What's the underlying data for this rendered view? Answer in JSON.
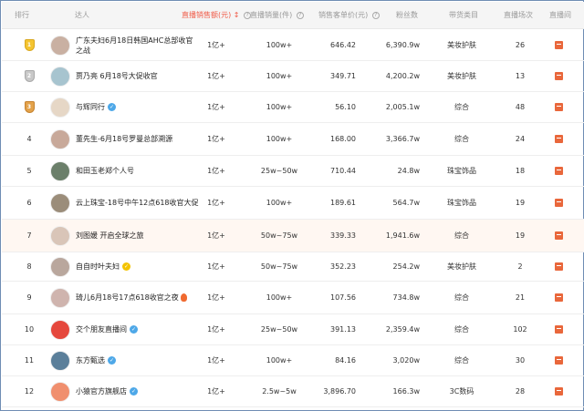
{
  "header": {
    "rank": "排行",
    "talent": "达人",
    "sales": "直播销售额(元)",
    "volume": "直播销量(件)",
    "price": "销售客单价(元)",
    "fans": "粉丝数",
    "category": "带货类目",
    "count": "直播场次",
    "live": "直播间",
    "info_glyph": "?",
    "sort_glyph": "↕"
  },
  "rows": [
    {
      "rank": "1",
      "medal": "gold",
      "name": "广东夫妇6月18日韩国AHC总部收官之战",
      "badge": "",
      "sales": "1亿+",
      "volume": "100w+",
      "price": "646.42",
      "fans": "6,390.9w",
      "category": "美妆护肤",
      "count": "26",
      "avatar_color": "#c9b0a2"
    },
    {
      "rank": "2",
      "medal": "silver",
      "name": "贾乃亮 6月18号大促收官",
      "badge": "",
      "sales": "1亿+",
      "volume": "100w+",
      "price": "349.71",
      "fans": "4,200.2w",
      "category": "美妆护肤",
      "count": "13",
      "avatar_color": "#a7c4cf"
    },
    {
      "rank": "3",
      "medal": "bronze",
      "name": "与辉同行",
      "badge": "blue",
      "sales": "1亿+",
      "volume": "100w+",
      "price": "56.10",
      "fans": "2,005.1w",
      "category": "综合",
      "count": "48",
      "avatar_color": "#e6d7c6"
    },
    {
      "rank": "4",
      "medal": "",
      "name": "董先生-6月18号罗曼总部溯源",
      "badge": "",
      "sales": "1亿+",
      "volume": "100w+",
      "price": "168.00",
      "fans": "3,366.7w",
      "category": "综合",
      "count": "24",
      "avatar_color": "#c8a99a"
    },
    {
      "rank": "5",
      "medal": "",
      "name": "和田玉老郑个人号",
      "badge": "",
      "sales": "1亿+",
      "volume": "25w~50w",
      "price": "710.44",
      "fans": "24.8w",
      "category": "珠宝饰品",
      "count": "18",
      "avatar_color": "#6b7f6a"
    },
    {
      "rank": "6",
      "medal": "",
      "name": "云上珠宝-18号中午12点618收官大促",
      "badge": "",
      "sales": "1亿+",
      "volume": "100w+",
      "price": "189.61",
      "fans": "564.7w",
      "category": "珠宝饰品",
      "count": "19",
      "avatar_color": "#9b8d7a"
    },
    {
      "rank": "7",
      "medal": "",
      "name": "刘图媛 开启全球之旅",
      "badge": "",
      "sales": "1亿+",
      "volume": "50w~75w",
      "price": "339.33",
      "fans": "1,941.6w",
      "category": "综合",
      "count": "19",
      "avatar_color": "#d9c5b8"
    },
    {
      "rank": "8",
      "medal": "",
      "name": "自自时叶夫妇",
      "badge": "gold",
      "sales": "1亿+",
      "volume": "50w~75w",
      "price": "352.23",
      "fans": "254.2w",
      "category": "美妆护肤",
      "count": "2",
      "avatar_color": "#b9a79d"
    },
    {
      "rank": "9",
      "medal": "",
      "name": "琦儿6月18号17点618收官之夜",
      "badge": "fire",
      "sales": "1亿+",
      "volume": "100w+",
      "price": "107.56",
      "fans": "734.8w",
      "category": "综合",
      "count": "21",
      "avatar_color": "#cfb4ae"
    },
    {
      "rank": "10",
      "medal": "",
      "name": "交个朋友直播间",
      "badge": "blue",
      "sales": "1亿+",
      "volume": "25w~50w",
      "price": "391.13",
      "fans": "2,359.4w",
      "category": "综合",
      "count": "102",
      "avatar_color": "#e5483d"
    },
    {
      "rank": "11",
      "medal": "",
      "name": "东方甄选",
      "badge": "blue",
      "sales": "1亿+",
      "volume": "100w+",
      "price": "84.16",
      "fans": "3,020w",
      "category": "综合",
      "count": "30",
      "avatar_color": "#5b7f9a"
    },
    {
      "rank": "12",
      "medal": "",
      "name": "小猿官方旗舰店",
      "badge": "blue",
      "sales": "1亿+",
      "volume": "2.5w~5w",
      "price": "3,896.70",
      "fans": "166.3w",
      "category": "3C数码",
      "count": "28",
      "avatar_color": "#f08f6e"
    }
  ],
  "colors": {
    "accent": "#f05a47",
    "verified": "#4ea8e8",
    "live": "#e9673b"
  }
}
